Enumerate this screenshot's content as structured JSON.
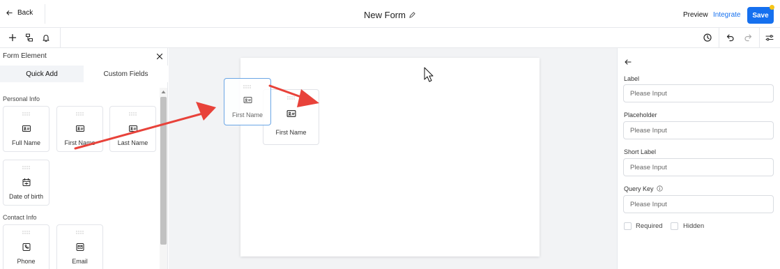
{
  "header": {
    "back_label": "Back",
    "title": "New Form",
    "title_edit_icon": "pencil-icon",
    "preview_label": "Preview",
    "integrate_label": "Integrate",
    "save_label": "Save"
  },
  "toolbar": {
    "left_icons": [
      "plus-icon",
      "layout-icon",
      "bell-icon"
    ],
    "right_icons": [
      "history-icon",
      "undo-icon",
      "redo-icon",
      "settings-sliders-icon"
    ]
  },
  "left_panel": {
    "title": "Form Element",
    "tabs": [
      {
        "label": "Quick Add",
        "active": true
      },
      {
        "label": "Custom Fields",
        "active": false
      }
    ],
    "sections": [
      {
        "label": "Personal Info",
        "items": [
          {
            "label": "Full Name",
            "icon": "id-card-icon"
          },
          {
            "label": "First Name",
            "icon": "id-card-icon"
          },
          {
            "label": "Last Name",
            "icon": "id-card-icon"
          },
          {
            "label": "Date of birth",
            "icon": "calendar-icon"
          }
        ]
      },
      {
        "label": "Contact Info",
        "items": [
          {
            "label": "Phone",
            "icon": "phone-icon"
          },
          {
            "label": "Email",
            "icon": "email-icon"
          }
        ]
      }
    ]
  },
  "canvas": {
    "dropped_field": {
      "label": "First Name",
      "icon": "id-card-icon"
    },
    "dragging_field": {
      "label": "First Name",
      "icon": "id-card-icon"
    }
  },
  "right_panel": {
    "fields": [
      {
        "label": "Label",
        "placeholder": "Please Input"
      },
      {
        "label": "Placeholder",
        "placeholder": "Please Input"
      },
      {
        "label": "Short Label",
        "placeholder": "Please Input"
      },
      {
        "label": "Query Key",
        "placeholder": "Please Input",
        "has_info_icon": true
      }
    ],
    "checkboxes": [
      {
        "label": "Required",
        "checked": false
      },
      {
        "label": "Hidden",
        "checked": false
      }
    ]
  },
  "colors": {
    "accent": "#1570ef",
    "annotation_arrow": "#e8423a",
    "drag_border": "#6aa5e5",
    "notification_dot": "#f5c518"
  }
}
